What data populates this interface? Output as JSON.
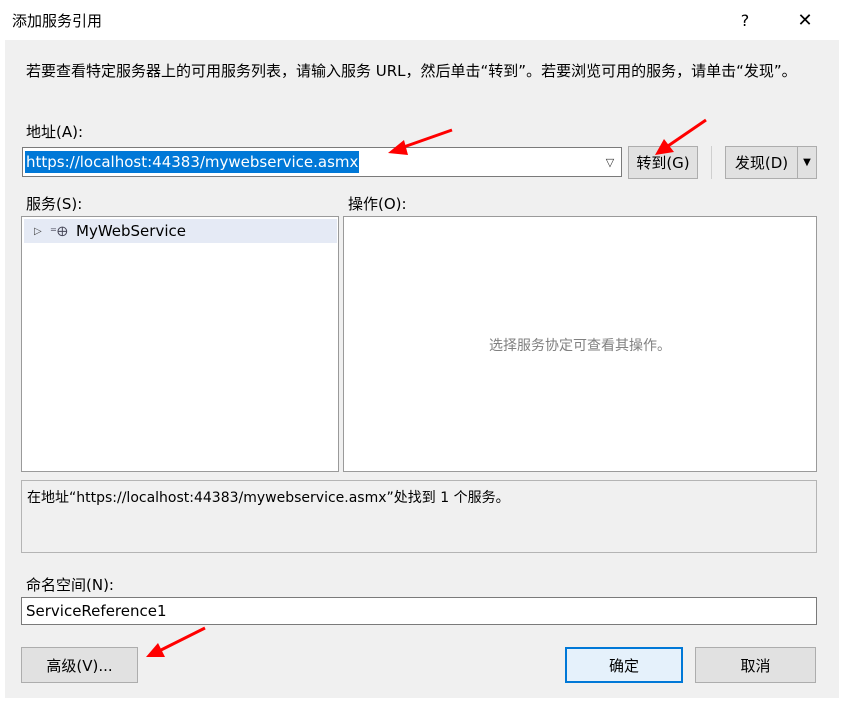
{
  "window": {
    "title": "添加服务引用",
    "help_label": "?",
    "close_label": "✕"
  },
  "instructions": "若要查看特定服务器上的可用服务列表，请输入服务 URL，然后单击“转到”。若要浏览可用的服务，请单击“发现”。",
  "address": {
    "label": "地址(A):",
    "value": "https://localhost:44383/mywebservice.asmx",
    "go_button": "转到(G)",
    "discover_button": "发现(D)"
  },
  "services": {
    "label": "服务(S):",
    "items": [
      {
        "label": "MyWebService"
      }
    ]
  },
  "operations": {
    "label": "操作(O):",
    "hint": "选择服务协定可查看其操作。"
  },
  "status_text": "在地址“https://localhost:44383/mywebservice.asmx”处找到 1 个服务。",
  "namespace": {
    "label": "命名空间(N):",
    "value": "ServiceReference1"
  },
  "buttons": {
    "advanced": "高级(V)...",
    "ok": "确定",
    "cancel": "取消"
  },
  "colors": {
    "selection": "#0078d7",
    "annotation_arrow": "#ff0000",
    "dialog_background": "#f0f0f0"
  },
  "icons": {
    "expand": "triangle-right",
    "service": "globe"
  }
}
